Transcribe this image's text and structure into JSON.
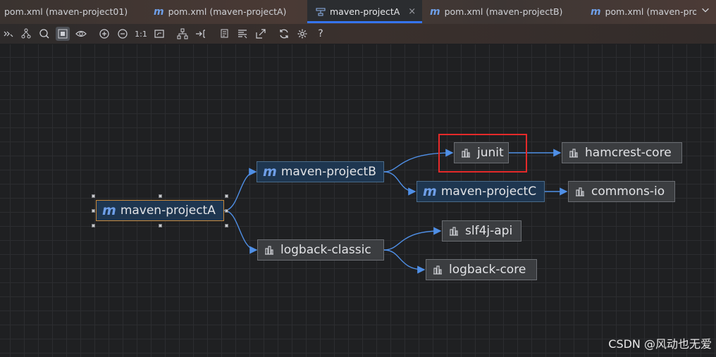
{
  "tabs": [
    {
      "label": "pom.xml (maven-project01)",
      "icon": "none",
      "active": false
    },
    {
      "label": "pom.xml (maven-projectA)",
      "icon": "maven-m-icon",
      "active": false
    },
    {
      "label": "maven-projectA",
      "icon": "diagram-icon",
      "active": true,
      "close": "×"
    },
    {
      "label": "pom.xml (maven-projectB)",
      "icon": "maven-m-icon",
      "active": false
    },
    {
      "label": "pom.xml (maven-pro",
      "icon": "maven-m-icon",
      "active": false
    }
  ],
  "maven_glyph": "m",
  "toolbar": {
    "actual_size_label": "1:1",
    "help_label": "?"
  },
  "nodes": {
    "projectA": "maven-projectA",
    "projectB": "maven-projectB",
    "projectC": "maven-projectC",
    "junit": "junit",
    "hamcrest": "hamcrest-core",
    "commons_io": "commons-io",
    "logback_classic": "logback-classic",
    "slf4j": "slf4j-api",
    "logback_core": "logback-core"
  },
  "colors": {
    "edge": "#4f8fe6",
    "highlight": "#e52a2a",
    "selection": "#c8893b",
    "maven_node": "#1e3650",
    "library_node": "#3b3d40"
  },
  "watermark": "CSDN @风动也无爱"
}
